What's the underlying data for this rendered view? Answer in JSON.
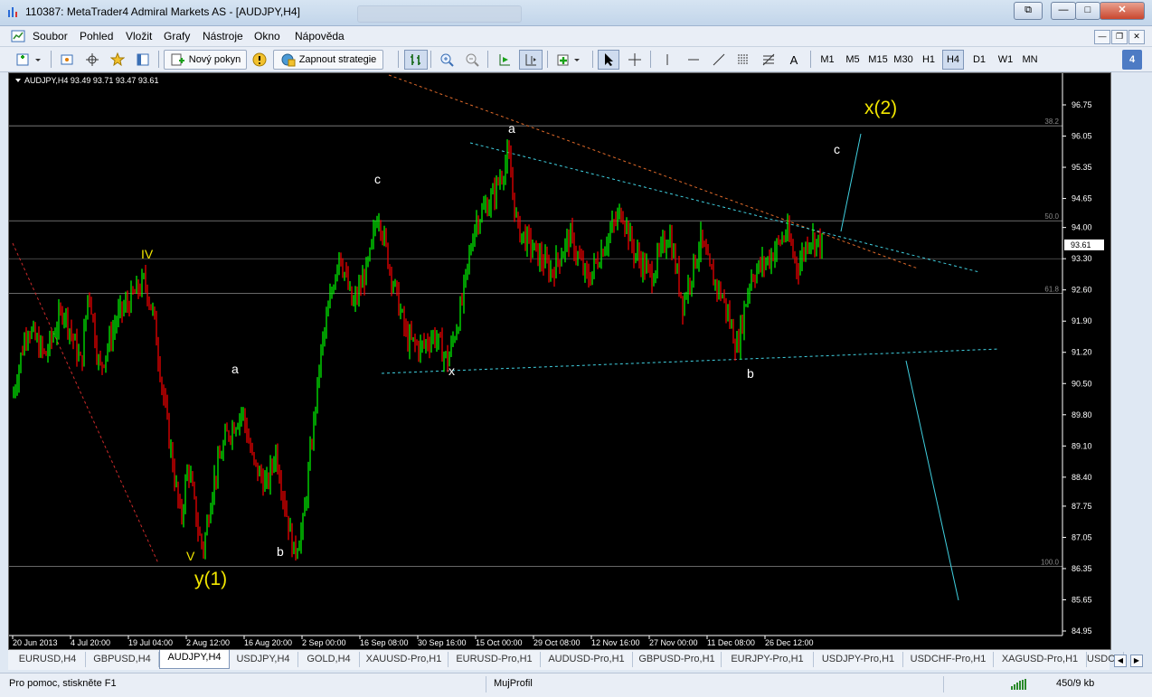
{
  "window": {
    "title": "110387: MetaTrader4 Admiral Markets AS - [AUDJPY,H4]",
    "btn_minimize": "—",
    "btn_maximize": "□",
    "btn_close": "✕",
    "btn_restore": "⧉"
  },
  "menu": [
    "Soubor",
    "Pohled",
    "Vložit",
    "Grafy",
    "Nástroje",
    "Okno",
    "Nápověda"
  ],
  "toolbar": {
    "new_order_label": "Nový pokyn",
    "strategy_label": "Zapnout strategie",
    "drawing_tools": [
      "cursor",
      "crosshair",
      "vertical-line",
      "horizontal-line",
      "trendline",
      "channel",
      "fibonacci",
      "text"
    ],
    "text_tool_label": "A",
    "timeframes": [
      "M1",
      "M5",
      "M15",
      "M30",
      "H1",
      "H4",
      "D1",
      "W1",
      "MN"
    ],
    "active_timeframe": "H4",
    "notifications_count": "4"
  },
  "chart": {
    "info": "AUDJPY,H4  93.49 93.71 93.47 93.61",
    "current_price": "93.61",
    "bull_color": "#00ff00",
    "bear_color": "#ff0000",
    "price_ticks": [
      "96.75",
      "96.05",
      "95.35",
      "94.65",
      "94.00",
      "93.30",
      "92.60",
      "91.90",
      "91.20",
      "90.50",
      "89.80",
      "89.10",
      "88.40",
      "87.75",
      "87.05",
      "86.35",
      "85.65",
      "84.95"
    ],
    "time_ticks": [
      "20 Jun 2013",
      "4 Jul 20:00",
      "19 Jul 04:00",
      "2 Aug 12:00",
      "16 Aug 20:00",
      "2 Sep 00:00",
      "16 Sep 08:00",
      "30 Sep 16:00",
      "15 Oct 00:00",
      "29 Oct 08:00",
      "12 Nov 16:00",
      "27 Nov 00:00",
      "11 Dec 08:00",
      "26 Dec 12:00"
    ],
    "fib_levels": [
      {
        "label": "38.2",
        "price": 96.28
      },
      {
        "label": "50.0",
        "price": 94.15
      },
      {
        "label": "61.8",
        "price": 92.52
      },
      {
        "label": "100.0",
        "price": 86.4
      }
    ],
    "wave_labels_small": [
      "IV",
      "V",
      "a",
      "b",
      "c",
      "x",
      "a",
      "b",
      "c"
    ],
    "wave_labels_big": [
      "y(1)",
      "x(2)"
    ]
  },
  "tabs": [
    "EURUSD,H4",
    "GBPUSD,H4",
    "AUDJPY,H4",
    "USDJPY,H4",
    "GOLD,H4",
    "XAUUSD-Pro,H1",
    "EURUSD-Pro,H1",
    "AUDUSD-Pro,H1",
    "GBPUSD-Pro,H1",
    "EURJPY-Pro,H1",
    "USDJPY-Pro,H1",
    "USDCHF-Pro,H1",
    "XAGUSD-Pro,H1",
    "USDCAI"
  ],
  "active_tab": "AUDJPY,H4",
  "status": {
    "help": "Pro pomoc, stiskněte F1",
    "profile": "MujProfil",
    "traffic": "450/9 kb"
  }
}
